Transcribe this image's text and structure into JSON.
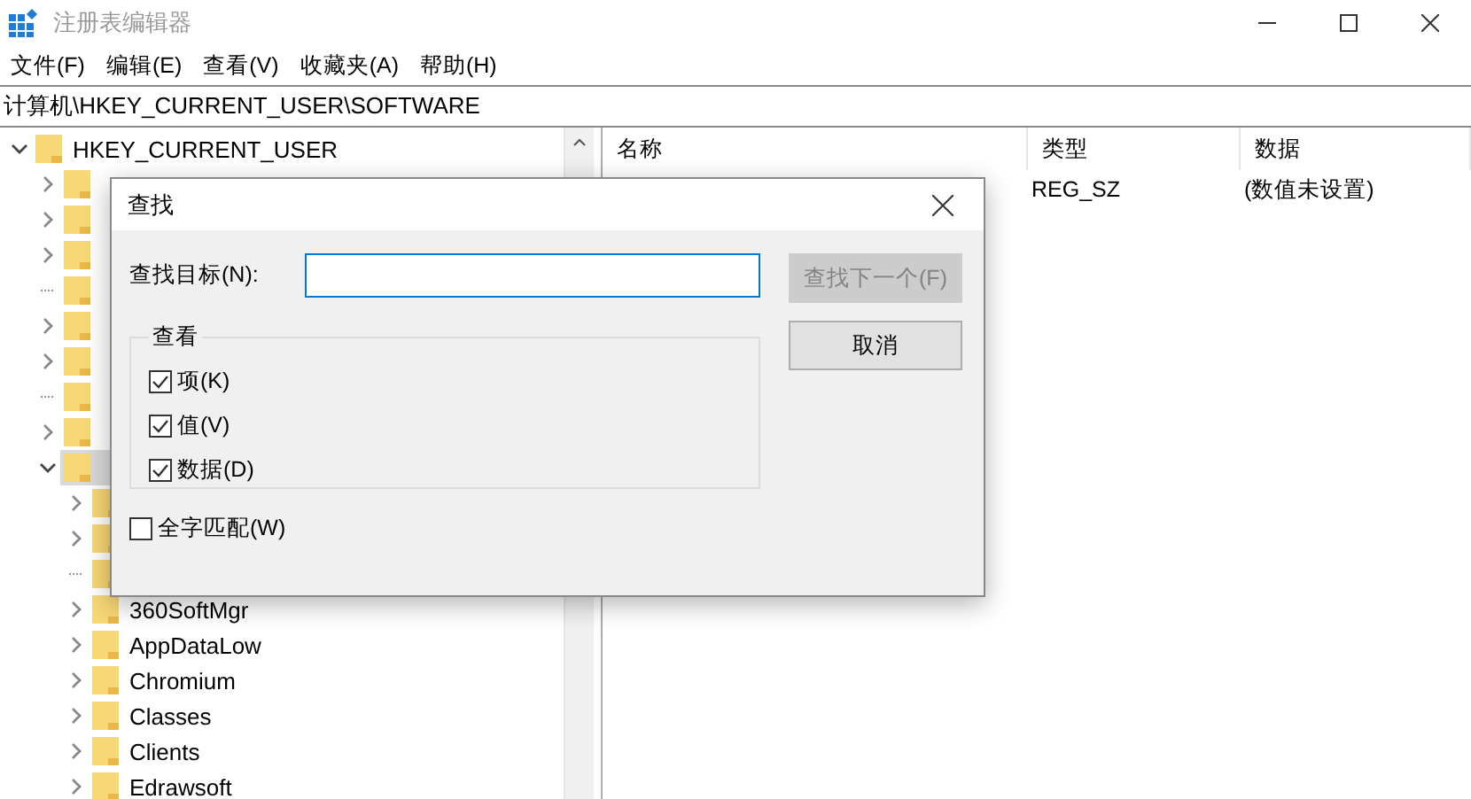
{
  "window": {
    "title": "注册表编辑器",
    "active": false
  },
  "menu": [
    "文件(F)",
    "编辑(E)",
    "查看(V)",
    "收藏夹(A)",
    "帮助(H)"
  ],
  "address": "计算机\\HKEY_CURRENT_USER\\SOFTWARE",
  "tree": [
    {
      "label": "HKEY_CURRENT_USER",
      "expanded": true,
      "selected": false,
      "has_children": true,
      "children": [
        {
          "has_children": true,
          "expanded": false,
          "selected": false
        },
        {
          "has_children": true,
          "expanded": false,
          "selected": false
        },
        {
          "has_children": true,
          "expanded": false,
          "selected": false
        },
        {
          "has_children": false,
          "selected": false
        },
        {
          "has_children": true,
          "expanded": false,
          "selected": false
        },
        {
          "has_children": true,
          "expanded": false,
          "selected": false
        },
        {
          "has_children": false,
          "selected": false
        },
        {
          "has_children": true,
          "expanded": false,
          "selected": false
        },
        {
          "has_children": true,
          "expanded": true,
          "selected": true,
          "children": [
            {
              "has_children": true,
              "expanded": false,
              "selected": false
            },
            {
              "has_children": true,
              "expanded": false,
              "selected": false
            },
            {
              "has_children": false,
              "selected": false
            },
            {
              "label": "360SoftMgr",
              "has_children": true,
              "expanded": false,
              "selected": false
            },
            {
              "label": "AppDataLow",
              "has_children": true,
              "expanded": false,
              "selected": false
            },
            {
              "label": "Chromium",
              "has_children": true,
              "expanded": false,
              "selected": false
            },
            {
              "label": "Classes",
              "has_children": true,
              "expanded": false,
              "selected": false
            },
            {
              "label": "Clients",
              "has_children": true,
              "expanded": false,
              "selected": false
            },
            {
              "label": "Edrawsoft",
              "has_children": true,
              "expanded": false,
              "selected": false
            }
          ]
        }
      ]
    }
  ],
  "values": {
    "columns": [
      "名称",
      "类型",
      "数据"
    ],
    "rows": [
      {
        "type": "REG_SZ",
        "data": "(数值未设置)"
      }
    ]
  },
  "dialog": {
    "title": "查找",
    "find_label": "查找目标(N):",
    "group_title": "查看",
    "options": [
      {
        "label": "项(K)",
        "checked": true
      },
      {
        "label": "值(V)",
        "checked": true
      },
      {
        "label": "数据(D)",
        "checked": true
      }
    ],
    "whole_word": {
      "label": "全字匹配(W)",
      "checked": false
    },
    "buttons": [
      {
        "label": "查找下一个(F)",
        "disabled": true
      },
      {
        "label": "取消",
        "disabled": false
      }
    ]
  }
}
